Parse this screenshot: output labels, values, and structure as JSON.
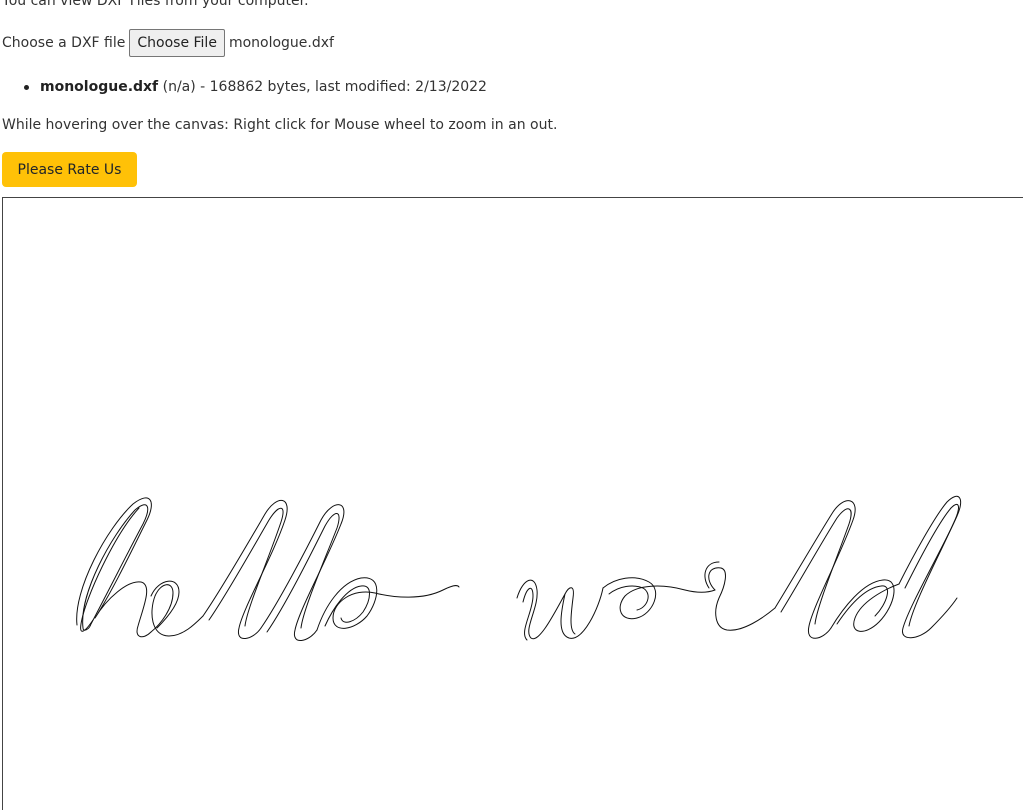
{
  "intro": {
    "text": "You can view DXF Files from your computer."
  },
  "file_picker": {
    "label": "Choose a DXF file",
    "button_label": "Choose File",
    "selected_file": "monologue.dxf"
  },
  "file_list": [
    {
      "name": "monologue.dxf",
      "details": " (n/a) - 168862 bytes, last modified: 2/13/2022"
    }
  ],
  "hint": {
    "text": "While hovering over the canvas: Right click for Mouse wheel to zoom in an out."
  },
  "rate_button": {
    "label": "Please Rate Us",
    "color": "#ffc107"
  },
  "canvas": {
    "drawing_text": "hello world",
    "stroke_color": "#111111"
  }
}
